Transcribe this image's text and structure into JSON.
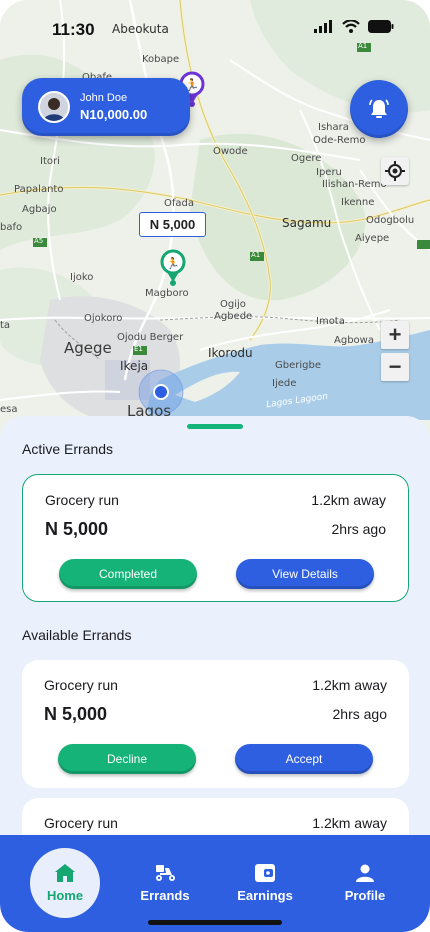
{
  "status_bar": {
    "time": "11:30"
  },
  "map": {
    "labels": {
      "abeokuta": "Abeokuta",
      "kobape": "Kobape",
      "obafe": "Obafe",
      "owode": "Owode",
      "ogere": "Ogere",
      "ishara": "Ishara",
      "ode_remo": "Ode-Remo",
      "iperu": "Iperu",
      "ilishan_remo": "Ilishan-Remo",
      "itori": "Itori",
      "papalanto": "Papalanto",
      "agbajo": "Agbajo",
      "ofada": "Ofada",
      "sagamu": "Sagamu",
      "ikenne": "Ikenne",
      "odogbolu": "Odogbolu",
      "aiyepe": "Aiyepe",
      "ijoko": "Ijoko",
      "magboro": "Magboro",
      "ogijo": "Ogijo",
      "agbede": "Agbede",
      "imota": "Imota",
      "agbowa": "Agbowa",
      "ojokoro": "Ojokoro",
      "ojodu_berger": "Ojodu Berger",
      "agege": "Agege",
      "ikeja": "Ikeja",
      "ikorodu": "Ikorodu",
      "gberigbe": "Gberigbe",
      "ijede": "Ijede",
      "lagos": "Lagos",
      "lagos_lagoon": "Lagos Lagoon",
      "ibafo_partial": "bafo",
      "ota_partial": "ta",
      "esa_partial": "esa",
      "a1_badge": "A1",
      "a5_badge": "A5",
      "e1_badge": "E1"
    },
    "price_tag": "N 5,000",
    "zoom_in": "+",
    "zoom_out": "−"
  },
  "user": {
    "name": "John Doe",
    "balance": "N10,000.00"
  },
  "active_errands": {
    "title": "Active Errands",
    "items": [
      {
        "name": "Grocery run",
        "distance": "1.2km away",
        "price": "N 5,000",
        "time": "2hrs ago",
        "left_action": "Completed",
        "right_action": "View Details"
      }
    ]
  },
  "available_errands": {
    "title": "Available Errands",
    "items": [
      {
        "name": "Grocery run",
        "distance": "1.2km away",
        "price": "N 5,000",
        "time": "2hrs ago",
        "left_action": "Decline",
        "right_action": "Accept"
      },
      {
        "name": "Grocery run",
        "distance": "1.2km away"
      }
    ]
  },
  "nav": {
    "items": [
      {
        "label": "Home",
        "icon": "home-icon",
        "active": true
      },
      {
        "label": "Errands",
        "icon": "delivery-scooter-icon"
      },
      {
        "label": "Earnings",
        "icon": "wallet-icon"
      },
      {
        "label": "Profile",
        "icon": "person-icon"
      }
    ]
  },
  "colors": {
    "primary": "#2d5fe0",
    "accent_green": "#16b378",
    "sheet_bg": "#eaf1fd"
  }
}
